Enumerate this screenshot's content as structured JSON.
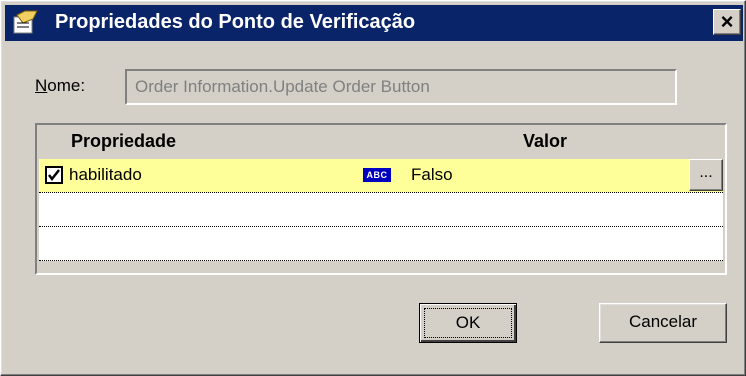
{
  "window": {
    "title": "Propriedades do Ponto de Verificação",
    "close_symbol": "×"
  },
  "form": {
    "name_label": "Nome:",
    "name_value": "Order Information.Update Order Button"
  },
  "grid": {
    "headers": {
      "property": "Propriedade",
      "value": "Valor"
    },
    "rows": [
      {
        "checked": true,
        "property": "habilitado",
        "type_badge": "ABC",
        "value": "Falso",
        "action": "..."
      }
    ]
  },
  "buttons": {
    "ok": "OK",
    "cancel": "Cancelar"
  },
  "icons": {
    "title_icon": "checkpoint-properties-icon",
    "type_icon": "string-type-icon",
    "check_icon": "checkmark-icon"
  }
}
